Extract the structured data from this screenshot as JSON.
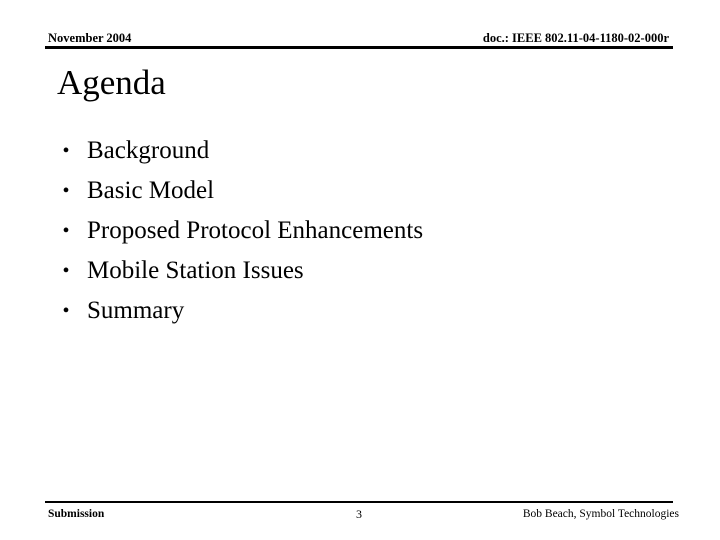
{
  "slide": {
    "background_color": "#ffffff",
    "text_color": "#000000"
  },
  "header": {
    "left": "November 2004",
    "right": "doc.: IEEE 802.11-04-1180-02-000r"
  },
  "title": "Agenda",
  "bullets": [
    {
      "marker": "•",
      "label": "Background"
    },
    {
      "marker": "•",
      "label": "Basic Model"
    },
    {
      "marker": "•",
      "label": "Proposed Protocol Enhancements"
    },
    {
      "marker": "•",
      "label": "Mobile Station Issues"
    },
    {
      "marker": "•",
      "label": "Summary"
    }
  ],
  "footer": {
    "left": "Submission",
    "page_number": "3",
    "right": "Bob Beach, Symbol Technologies"
  }
}
